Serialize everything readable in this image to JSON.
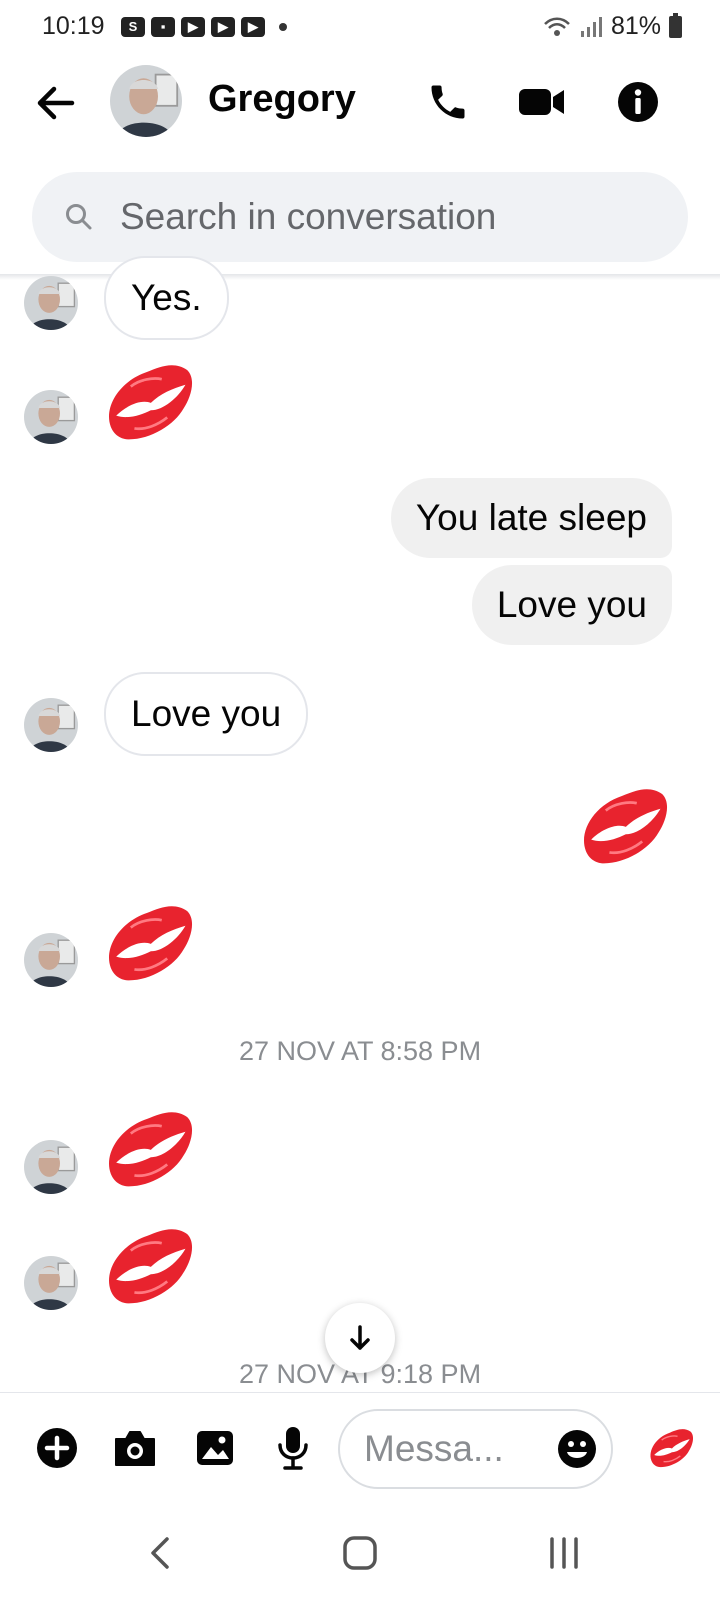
{
  "status_bar": {
    "time": "10:19",
    "battery": "81%",
    "notification_icons": [
      "shop-icon",
      "folder-icon",
      "youtube-icon",
      "youtube-icon",
      "youtube-icon"
    ]
  },
  "header": {
    "contact_name": "Gregory",
    "icons": [
      "back-arrow-icon",
      "phone-icon",
      "video-camera-icon",
      "info-icon"
    ]
  },
  "search": {
    "placeholder": "Search in conversation"
  },
  "messages": [
    {
      "side": "in",
      "type": "text",
      "text": "Yes."
    },
    {
      "side": "in",
      "type": "emoji",
      "emoji": "kiss-mark"
    },
    {
      "side": "out",
      "type": "text",
      "text": "You late sleep"
    },
    {
      "side": "out",
      "type": "text",
      "text": "Love you"
    },
    {
      "side": "in",
      "type": "text",
      "text": "Love you"
    },
    {
      "side": "out",
      "type": "emoji",
      "emoji": "kiss-mark"
    },
    {
      "side": "in",
      "type": "emoji",
      "emoji": "kiss-mark"
    },
    {
      "type": "timestamp",
      "text": "27 NOV AT 8:58 PM"
    },
    {
      "side": "in",
      "type": "emoji",
      "emoji": "kiss-mark"
    },
    {
      "side": "in",
      "type": "emoji",
      "emoji": "kiss-mark"
    },
    {
      "type": "timestamp",
      "text": "27 NOV AT 9:18 PM"
    }
  ],
  "composer": {
    "placeholder": "Messa...",
    "icons": [
      "plus-icon",
      "camera-icon",
      "gallery-icon",
      "microphone-icon",
      "emoji-icon",
      "kiss-mark-icon"
    ]
  },
  "nav_bar": {
    "icons": [
      "back-icon",
      "home-icon",
      "recents-icon"
    ]
  },
  "colors": {
    "kiss_red": "#e8232e",
    "incoming_border": "#e4e6eb",
    "outgoing_bg": "#f0f0f0",
    "timestamp": "#8a8d91"
  }
}
